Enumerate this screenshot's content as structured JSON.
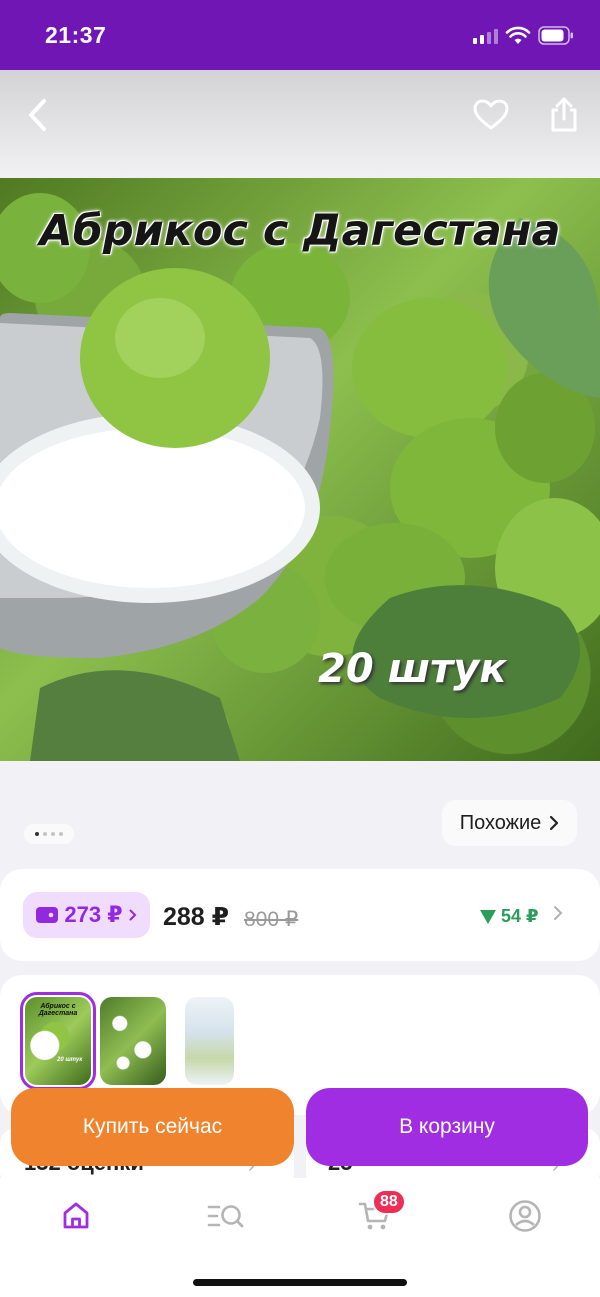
{
  "status_bar": {
    "time": "21:37",
    "signal_icon": "cellular-signal-icon",
    "wifi_icon": "wifi-icon",
    "battery_icon": "battery-icon"
  },
  "top_bar": {
    "back_icon": "chevron-left-icon",
    "favorite_icon": "heart-icon",
    "share_icon": "share-icon"
  },
  "product_image": {
    "title": "Абрикос с Дагестана",
    "count": "20 штук",
    "slides_total": 4,
    "slide_current": 1
  },
  "similar": {
    "label": "Похожие"
  },
  "price": {
    "wallet_price": "273 ₽",
    "price": "288 ₽",
    "old_price": "800 ₽",
    "delta": "54 ₽"
  },
  "thumbnails": [
    {
      "title": "Абрикос с Дагестана",
      "count": "20 штук"
    },
    {
      "title": ""
    },
    {
      "title": ""
    }
  ],
  "buttons": {
    "buy_now": "Купить сейчас",
    "add_to_cart": "В корзину"
  },
  "underlying_cards": {
    "ratings": "132 оценки",
    "questions": "25"
  },
  "tab_bar": {
    "cart_badge": "88"
  },
  "colors": {
    "brand_purple": "#a12de3",
    "status_purple": "#6f16b5",
    "buy_orange": "#f0842e",
    "price_down_green": "#2a9d5a",
    "badge_red": "#ef2e55"
  }
}
